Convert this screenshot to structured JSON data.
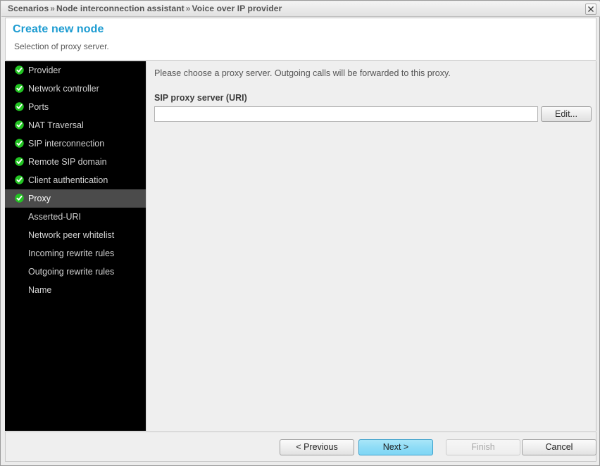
{
  "window": {
    "breadcrumb": [
      "Scenarios",
      "Node interconnection assistant",
      "Voice over IP provider"
    ],
    "breadcrumb_separator": "»",
    "close_label": "close-window"
  },
  "header": {
    "title": "Create new node",
    "subtitle": "Selection of proxy server.",
    "title_color": "#1b9bd1"
  },
  "sidebar": {
    "selected_index": 7,
    "highlight_color": "#4b4b4b",
    "background_color": "#000000",
    "check_color": "#22c422",
    "items": [
      {
        "label": "Provider",
        "completed": true,
        "selected": false
      },
      {
        "label": "Network controller",
        "completed": true,
        "selected": false
      },
      {
        "label": "Ports",
        "completed": true,
        "selected": false
      },
      {
        "label": "NAT Traversal",
        "completed": true,
        "selected": false
      },
      {
        "label": "SIP interconnection",
        "completed": true,
        "selected": false
      },
      {
        "label": "Remote SIP domain",
        "completed": true,
        "selected": false
      },
      {
        "label": "Client authentication",
        "completed": true,
        "selected": false
      },
      {
        "label": "Proxy",
        "completed": true,
        "selected": true
      },
      {
        "label": "Asserted-URI",
        "completed": false,
        "selected": false
      },
      {
        "label": "Network peer whitelist",
        "completed": false,
        "selected": false
      },
      {
        "label": "Incoming rewrite rules",
        "completed": false,
        "selected": false
      },
      {
        "label": "Outgoing rewrite rules",
        "completed": false,
        "selected": false
      },
      {
        "label": "Name",
        "completed": false,
        "selected": false
      }
    ]
  },
  "content": {
    "intro": "Please choose a proxy server. Outgoing calls will be forwarded to this proxy.",
    "field_label": "SIP proxy server (URI)",
    "input_value": "",
    "input_placeholder": "",
    "edit_label": "Edit..."
  },
  "footer": {
    "previous_label": "< Previous",
    "next_label": "Next >",
    "finish_label": "Finish",
    "cancel_label": "Cancel",
    "primary_button": "next",
    "disabled_button": "finish"
  }
}
